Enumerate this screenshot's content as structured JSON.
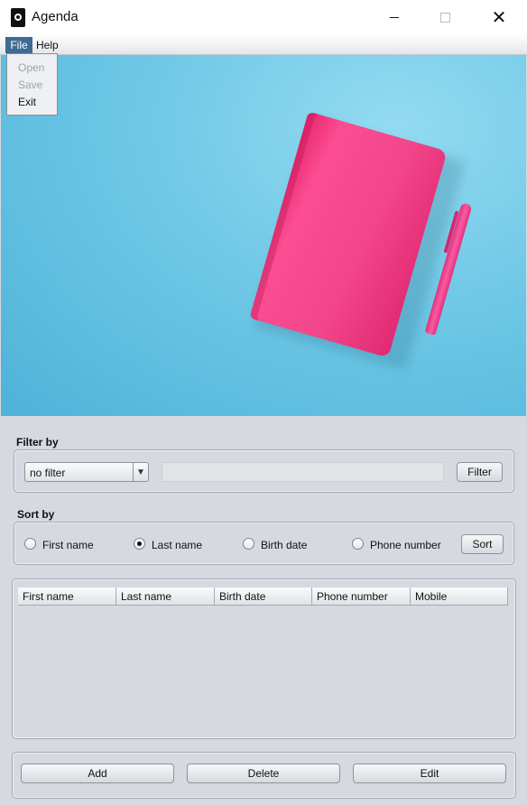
{
  "window": {
    "title": "Agenda",
    "minimize_glyph": "",
    "maximize_glyph": "",
    "close_glyph": "✕"
  },
  "menu": {
    "file": "File",
    "help": "Help",
    "file_items": [
      {
        "label": "Open",
        "enabled": false
      },
      {
        "label": "Save",
        "enabled": false
      },
      {
        "label": "Exit",
        "enabled": true
      }
    ]
  },
  "filter": {
    "section_label": "Filter by",
    "selected_option": "no filter",
    "input_value": "",
    "button_label": "Filter"
  },
  "sort": {
    "section_label": "Sort by",
    "options": [
      {
        "label": "First name",
        "selected": false
      },
      {
        "label": "Last name",
        "selected": true
      },
      {
        "label": "Birth date",
        "selected": false
      },
      {
        "label": "Phone number",
        "selected": false
      }
    ],
    "button_label": "Sort"
  },
  "table": {
    "columns": [
      "First name",
      "Last name",
      "Birth date",
      "Phone number",
      "Mobile"
    ],
    "rows": []
  },
  "actions": {
    "add_label": "Add",
    "delete_label": "Delete",
    "edit_label": "Edit"
  },
  "colors": {
    "menu_active_bg": "#3f6a92",
    "window_bg": "#d6d9df",
    "banner_sky": "#6fc8e6",
    "notebook_pink": "#f34589"
  }
}
